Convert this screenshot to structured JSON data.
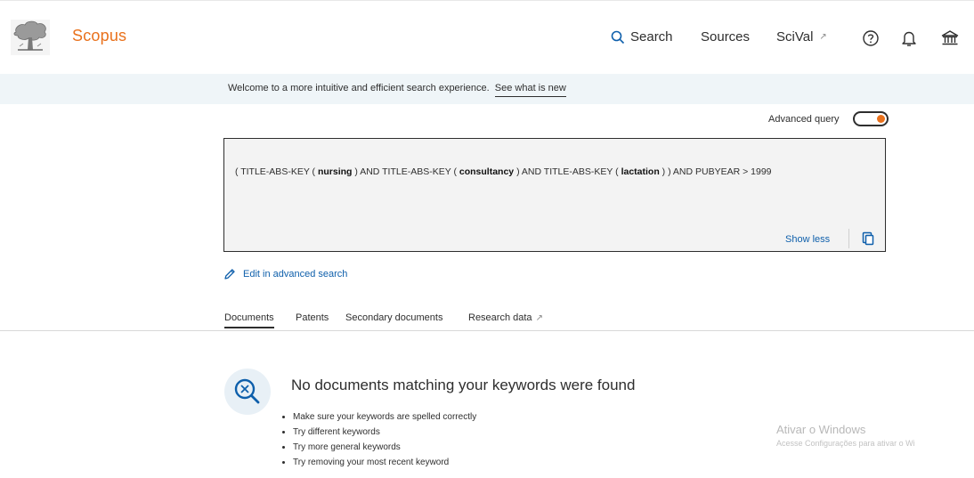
{
  "header": {
    "brand": "Scopus",
    "nav": {
      "search": "Search",
      "sources": "Sources",
      "scival": "SciVal",
      "scival_external": "↗"
    },
    "icons": [
      "help-icon",
      "bell-icon",
      "institution-icon"
    ]
  },
  "banner": {
    "text": "Welcome to a more intuitive and efficient search experience.",
    "link": "See what is new"
  },
  "advanced_query": {
    "label": "Advanced query",
    "enabled": true
  },
  "query": {
    "parts": [
      "( TITLE-ABS-KEY ( ",
      "nursing",
      " ) AND TITLE-ABS-KEY ( ",
      "consultancy",
      " ) AND TITLE-ABS-KEY ( ",
      "lactation",
      " ) ) AND PUBYEAR > 1999"
    ],
    "show_less": "Show less"
  },
  "edit_link": "Edit in advanced search",
  "tabs": [
    {
      "label": "Documents",
      "active": true
    },
    {
      "label": "Patents",
      "active": false
    },
    {
      "label": "Secondary documents",
      "active": false
    },
    {
      "label": "Research data",
      "active": false,
      "external": "↗"
    }
  ],
  "empty_state": {
    "title": "No documents matching your keywords were found",
    "tips": [
      "Make sure your keywords are spelled correctly",
      "Try different keywords",
      "Try more general keywords",
      "Try removing your most recent keyword"
    ]
  },
  "watermark": {
    "title": "Ativar o Windows",
    "subtitle": "Acesse Configurações para ativar o Wi"
  },
  "colors": {
    "brand_orange": "#e9711c",
    "link_blue": "#0e5fab",
    "banner_bg": "#eff5f8",
    "query_bg": "#f3f3f3"
  }
}
